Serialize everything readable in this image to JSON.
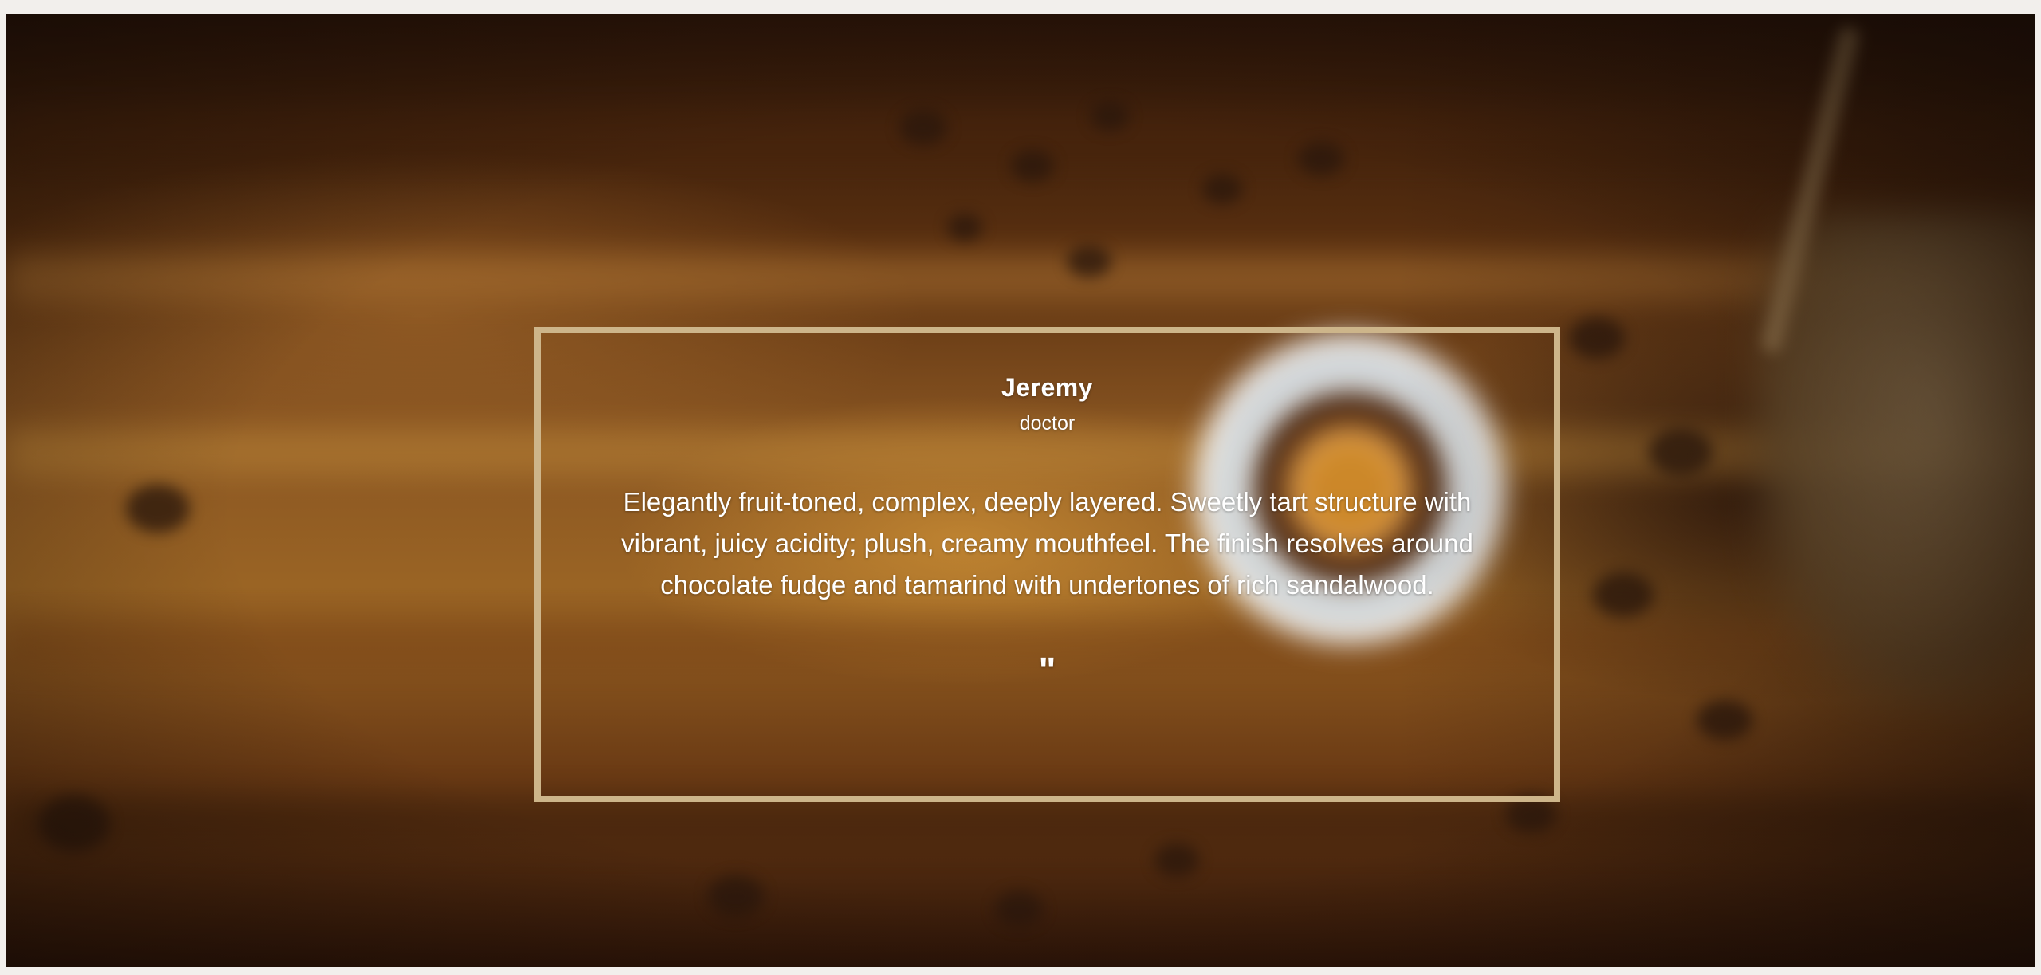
{
  "testimonial": {
    "name": "Jeremy",
    "role": "doctor",
    "quote": "Elegantly fruit-toned, complex, deeply layered. Sweetly tart structure with vibrant, juicy acidity; plush, creamy mouthfeel. The finish resolves around chocolate fudge and tamarind with undertones of rich sandalwood.",
    "quote_mark": "\""
  },
  "colors": {
    "frame_border": "#cdb58a",
    "text": "#ffffff"
  }
}
